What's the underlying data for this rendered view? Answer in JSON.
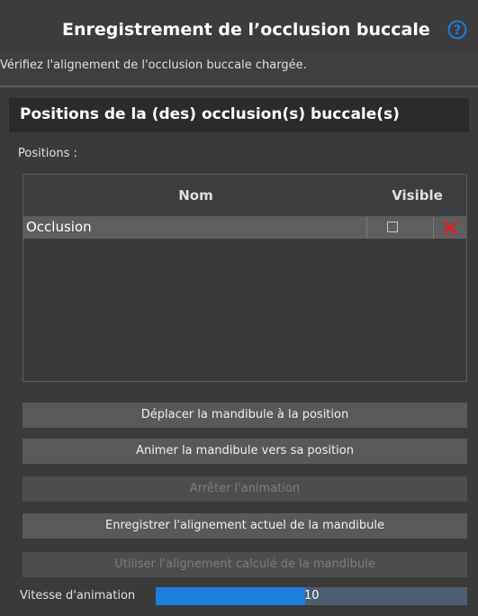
{
  "header": {
    "title": "Enregistrement de l’occlusion buccale",
    "help_icon": "help-circle-icon"
  },
  "instruction": "Vérifiez l'alignement de l'occlusion buccale chargée.",
  "section": {
    "title": "Positions de la (des) occlusion(s) buccale(s)",
    "positions_label": "Positions :"
  },
  "table": {
    "columns": [
      "Nom",
      "Visible"
    ],
    "rows": [
      {
        "name": "Occlusion",
        "visible": false,
        "delete_icon": "close-x-icon"
      }
    ]
  },
  "buttons": [
    {
      "label": "Déplacer la mandibule à la position",
      "enabled": true
    },
    {
      "label": "Animer la mandibule vers sa position",
      "enabled": true
    },
    {
      "label": "Arrêter l'animation",
      "enabled": false
    },
    {
      "label": "Enregistrer l'alignement actuel de la mandibule",
      "enabled": true
    },
    {
      "label": "Utiliser l'alignement calculé de la mandibule",
      "enabled": false
    }
  ],
  "animation_speed": {
    "label": "Vitesse d'animation",
    "value": "10",
    "fraction": 0.48
  },
  "colors": {
    "accent": "#1e7ee0",
    "delete": "#e02020",
    "help": "#1e7ee0"
  }
}
